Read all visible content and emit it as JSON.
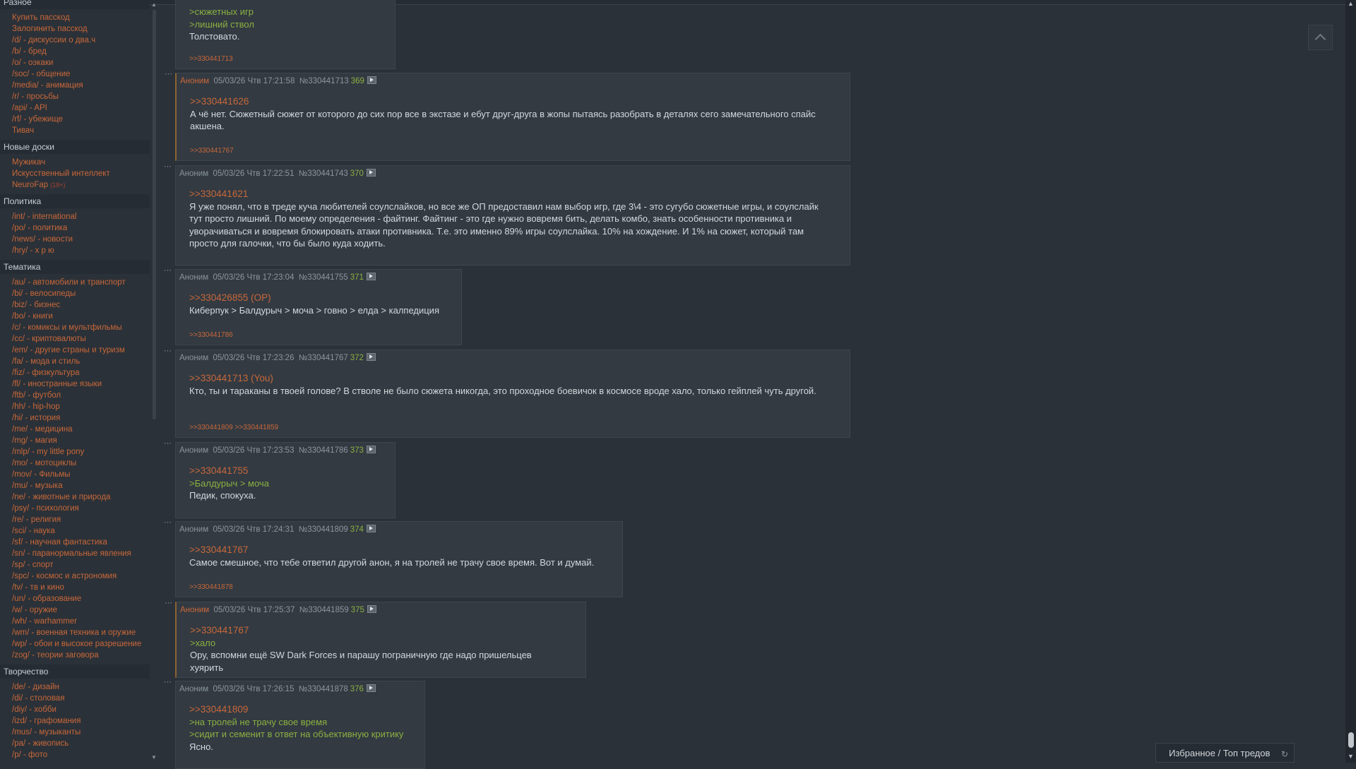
{
  "sidebar": {
    "sections": [
      {
        "title": "Разное",
        "items": [
          {
            "label": "Купить пасскод"
          },
          {
            "label": "Залогинить пасскод"
          },
          {
            "label": "/d/ - дискуссии о два.ч"
          },
          {
            "label": "/b/ - бред"
          },
          {
            "label": "/o/ - оэкаки"
          },
          {
            "label": "/soc/ - общение"
          },
          {
            "label": "/media/ - анимация"
          },
          {
            "label": "/r/ - просьбы"
          },
          {
            "label": "/api/ - API"
          },
          {
            "label": "/rf/ - убежище"
          },
          {
            "label": "Тивач"
          }
        ]
      },
      {
        "title": "Новые доски",
        "items": [
          {
            "label": "Мужикач"
          },
          {
            "label": "Искусственный интеллект"
          },
          {
            "label": "NeuroFap",
            "badge": "(18+)"
          }
        ]
      },
      {
        "title": "Политика",
        "items": [
          {
            "label": "/int/ - international"
          },
          {
            "label": "/po/ - политика"
          },
          {
            "label": "/news/ - новости"
          },
          {
            "label": "/hry/ - х р ю"
          }
        ]
      },
      {
        "title": "Тематика",
        "items": [
          {
            "label": "/au/ - автомобили и транспорт"
          },
          {
            "label": "/bi/ - велосипеды"
          },
          {
            "label": "/biz/ - бизнес"
          },
          {
            "label": "/bo/ - книги"
          },
          {
            "label": "/c/ - комиксы и мультфильмы"
          },
          {
            "label": "/cc/ - криптовалюты"
          },
          {
            "label": "/em/ - другие страны и туризм"
          },
          {
            "label": "/fa/ - мода и стиль"
          },
          {
            "label": "/fiz/ - физкультура"
          },
          {
            "label": "/fl/ - иностранные языки"
          },
          {
            "label": "/ftb/ - футбол"
          },
          {
            "label": "/hh/ - hip-hop"
          },
          {
            "label": "/hi/ - история"
          },
          {
            "label": "/me/ - медицина"
          },
          {
            "label": "/mg/ - магия"
          },
          {
            "label": "/mlp/ - my little pony"
          },
          {
            "label": "/mo/ - мотоциклы"
          },
          {
            "label": "/mov/ - Фильмы"
          },
          {
            "label": "/mu/ - музыка"
          },
          {
            "label": "/ne/ - животные и природа"
          },
          {
            "label": "/psy/ - психология"
          },
          {
            "label": "/re/ - религия"
          },
          {
            "label": "/sci/ - наука"
          },
          {
            "label": "/sf/ - научная фантастика"
          },
          {
            "label": "/sn/ - паранормальные явления"
          },
          {
            "label": "/sp/ - спорт"
          },
          {
            "label": "/spc/ - космос и астрономия"
          },
          {
            "label": "/tv/ - тв и кино"
          },
          {
            "label": "/un/ - образование"
          },
          {
            "label": "/w/ - оружие"
          },
          {
            "label": "/wh/ - warhammer"
          },
          {
            "label": "/wm/ - военная техника и оружие"
          },
          {
            "label": "/wp/ - обои и высокое разрешение"
          },
          {
            "label": "/zog/ - теории заговора"
          }
        ]
      },
      {
        "title": "Творчество",
        "items": [
          {
            "label": "/de/ - дизайн"
          },
          {
            "label": "/di/ - столовая"
          },
          {
            "label": "/diy/ - хобби"
          },
          {
            "label": "/izd/ - графомания"
          },
          {
            "label": "/mus/ - музыканты"
          },
          {
            "label": "/pa/ - живопись"
          },
          {
            "label": "/p/ - фото"
          }
        ]
      }
    ]
  },
  "posts": [
    {
      "mine": false,
      "header": null,
      "lines": [
        {
          "type": "green",
          "text": ">сюжетных игр"
        },
        {
          "type": "green",
          "text": ">лишний ствол"
        },
        {
          "type": "text",
          "text": "Толстовато."
        }
      ],
      "refs": ">>330441713"
    },
    {
      "mine": true,
      "header": {
        "name": "Аноним",
        "date": "05/03/26 Чтв 17:21:58",
        "id": "№330441713",
        "num": "369"
      },
      "lines": [
        {
          "type": "reply",
          "text": ">>330441626"
        },
        {
          "type": "text",
          "text": "А чё нет. Сюжетный сюжет от которого до сих пор все в экстазе и ебут друг-друга в жопы пытаясь разобрать в деталях сего замечательного спайс акшена."
        }
      ],
      "refs": ">>330441767"
    },
    {
      "mine": false,
      "header": {
        "name": "Аноним",
        "date": "05/03/26 Чтв 17:22:51",
        "id": "№330441743",
        "num": "370"
      },
      "lines": [
        {
          "type": "reply",
          "text": ">>330441621"
        },
        {
          "type": "text",
          "text": "Я уже понял, что в треде куча любителей соулслайков, но все же ОП предоставил нам выбор игр, где 3\\4 - это сугубо сюжетные игры, и соулслайк тут просто лишний. По моему определения - файтинг. Файтинг - это где нужно вовремя бить, делать комбо, знать особенности противника и уворачиваться и вовремя блокировать атаки противника. Т.е. это именно 89% игры соулслайка. 10% на хождение. И 1% на сюжет, который там просто для галочки, что бы было куда ходить."
        }
      ],
      "refs": ""
    },
    {
      "mine": false,
      "header": {
        "name": "Аноним",
        "date": "05/03/26 Чтв 17:23:04",
        "id": "№330441755",
        "num": "371"
      },
      "lines": [
        {
          "type": "reply",
          "text": ">>330426855 (OP)"
        },
        {
          "type": "text",
          "text": "Киберпук > Балдурыч > моча > говно > елда > калпедиция"
        }
      ],
      "refs": ">>330441786"
    },
    {
      "mine": false,
      "header": {
        "name": "Аноним",
        "date": "05/03/26 Чтв 17:23:26",
        "id": "№330441767",
        "num": "372"
      },
      "lines": [
        {
          "type": "reply",
          "text": ">>330441713 (You)"
        },
        {
          "type": "text",
          "text": "Кто, ты и тараканы в твоей голове? В стволе не было сюжета никогда, это проходное боевичок в космосе вроде халo, только гейплей чуть другой."
        }
      ],
      "refs": ">>330441809 >>330441859"
    },
    {
      "mine": false,
      "header": {
        "name": "Аноним",
        "date": "05/03/26 Чтв 17:23:53",
        "id": "№330441786",
        "num": "373"
      },
      "lines": [
        {
          "type": "reply",
          "text": ">>330441755"
        },
        {
          "type": "green",
          "text": ">Балдурыч > моча"
        },
        {
          "type": "text",
          "text": "Педик, спокуха."
        }
      ],
      "refs": ""
    },
    {
      "mine": false,
      "header": {
        "name": "Аноним",
        "date": "05/03/26 Чтв 17:24:31",
        "id": "№330441809",
        "num": "374"
      },
      "lines": [
        {
          "type": "reply",
          "text": ">>330441767"
        },
        {
          "type": "text",
          "text": "Самое смешное, что тебе ответил другой анон, я на тролей не трачу свое время. Вот и думай."
        }
      ],
      "refs": ">>330441878"
    },
    {
      "mine": true,
      "header": {
        "name": "Аноним",
        "date": "05/03/26 Чтв 17:25:37",
        "id": "№330441859",
        "num": "375"
      },
      "lines": [
        {
          "type": "reply",
          "text": ">>330441767"
        },
        {
          "type": "green",
          "text": ">хало"
        },
        {
          "type": "text",
          "text": "Ору, вспомни ещё SW Dark Forces и парашу пограничную где надо пришельцев хуярить"
        }
      ],
      "refs": ""
    },
    {
      "mine": false,
      "header": {
        "name": "Аноним",
        "date": "05/03/26 Чтв 17:26:15",
        "id": "№330441878",
        "num": "376"
      },
      "lines": [
        {
          "type": "reply",
          "text": ">>330441809"
        },
        {
          "type": "green",
          "text": ">на тролей не трачу свое время"
        },
        {
          "type": "green",
          "text": ">сидит и семенит в ответ на объективную критику"
        },
        {
          "type": "text",
          "text": "Ясно."
        }
      ],
      "refs": ""
    }
  ],
  "favorites_bar": {
    "label": "Избранное / Топ тредов"
  },
  "colors": {
    "link": "#c8683a",
    "greentext": "#8ab040",
    "post_bg": "#333a42",
    "page_bg": "#2b3138"
  }
}
